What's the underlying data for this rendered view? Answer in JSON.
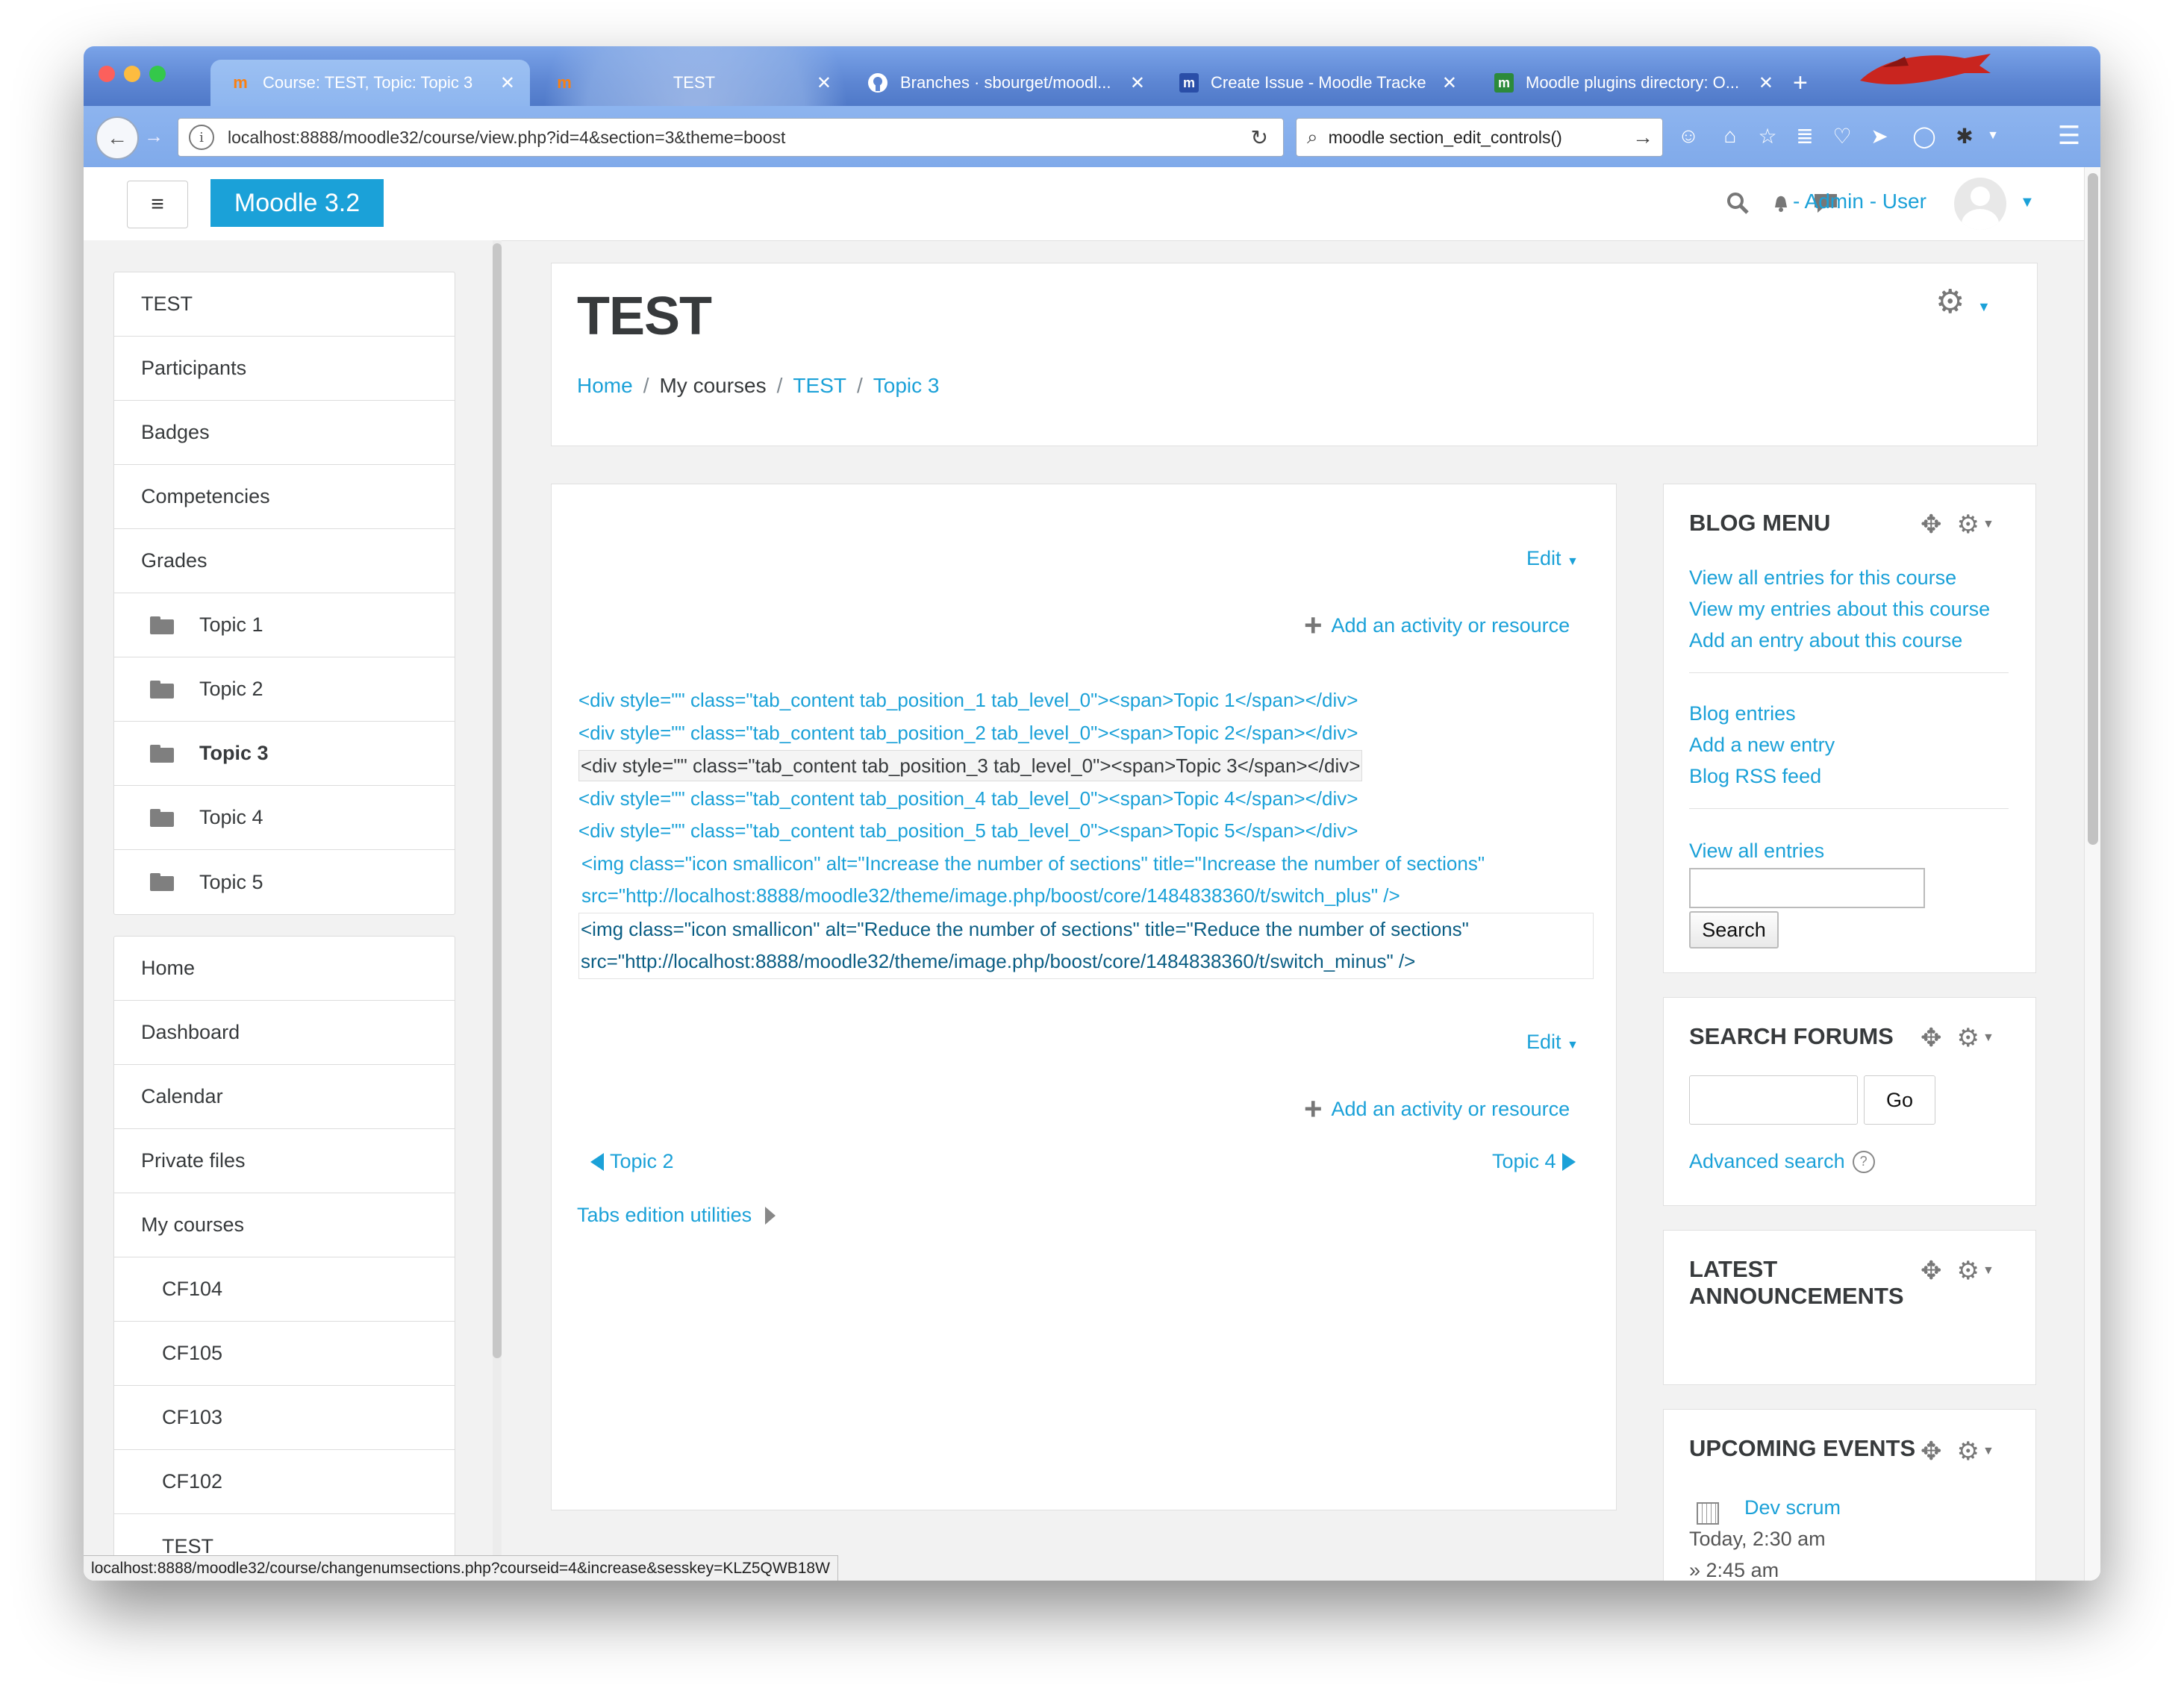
{
  "browser": {
    "tabs": [
      {
        "title": "Course: TEST, Topic: Topic 3",
        "icon": "moodle-icon",
        "active": true
      },
      {
        "title": "TEST",
        "icon": "moodle-icon",
        "active": false
      },
      {
        "title": "Branches · sbourget/moodl...",
        "icon": "github-icon",
        "active": false
      },
      {
        "title": "Create Issue - Moodle Tracker",
        "icon": "moodle-tracker-icon",
        "active": false
      },
      {
        "title": "Moodle plugins directory: O...",
        "icon": "moodle-icon",
        "active": false
      }
    ],
    "url": "localhost:8888/moodle32/course/view.php?id=4&section=3&theme=boost",
    "search_value": "moodle section_edit_controls()"
  },
  "header": {
    "brand": "Moodle 3.2",
    "user_label": "- Admin - User"
  },
  "drawer": {
    "course_items": [
      {
        "label": "TEST"
      },
      {
        "label": "Participants"
      },
      {
        "label": "Badges"
      },
      {
        "label": "Competencies"
      },
      {
        "label": "Grades"
      },
      {
        "label": "Topic 1",
        "folder": true
      },
      {
        "label": "Topic 2",
        "folder": true
      },
      {
        "label": "Topic 3",
        "folder": true,
        "current": true
      },
      {
        "label": "Topic 4",
        "folder": true
      },
      {
        "label": "Topic 5",
        "folder": true
      }
    ],
    "site_items": [
      {
        "label": "Home"
      },
      {
        "label": "Dashboard"
      },
      {
        "label": "Calendar"
      },
      {
        "label": "Private files"
      },
      {
        "label": "My courses"
      },
      {
        "label": "CF104",
        "indent": true
      },
      {
        "label": "CF105",
        "indent": true
      },
      {
        "label": "CF103",
        "indent": true
      },
      {
        "label": "CF102",
        "indent": true
      },
      {
        "label": "TEST",
        "indent": true
      }
    ]
  },
  "course_header": {
    "title": "TEST",
    "breadcrumb": {
      "home": "Home",
      "my_courses": "My courses",
      "course": "TEST",
      "section": "Topic 3"
    }
  },
  "main": {
    "edit_label": "Edit",
    "add_activity_label": "Add an activity or resource",
    "code_lines": [
      "<div style=\"\" class=\"tab_content tab_position_1 tab_level_0\"><span>Topic 1</span></div>",
      "<div style=\"\" class=\"tab_content tab_position_2 tab_level_0\"><span>Topic 2</span></div>",
      "<div style=\"\" class=\"tab_content tab_position_3 tab_level_0\"><span>Topic 3</span></div>",
      "<div style=\"\" class=\"tab_content tab_position_4 tab_level_0\"><span>Topic 4</span></div>",
      "<div style=\"\" class=\"tab_content tab_position_5 tab_level_0\"><span>Topic 5</span></div>",
      "<img class=\"icon smallicon\" alt=\"Increase the number of sections\" title=\"Increase the number of sections\"",
      "src=\"http://localhost:8888/moodle32/theme/image.php/boost/core/1484838360/t/switch_plus\" />",
      "<img class=\"icon smallicon\" alt=\"Reduce the number of sections\" title=\"Reduce the number of sections\"",
      "src=\"http://localhost:8888/moodle32/theme/image.php/boost/core/1484838360/t/switch_minus\" />"
    ],
    "prev_section": "Topic 2",
    "next_section": "Topic 4",
    "tabs_utilities": "Tabs edition utilities"
  },
  "blocks": {
    "blog_menu": {
      "title": "BLOG MENU",
      "links": [
        "View all entries for this course",
        "View my entries about this course",
        "Add an entry about this course"
      ],
      "links2": [
        "Blog entries",
        "Add a new entry",
        "Blog RSS feed"
      ],
      "view_all": "View all entries",
      "search_button": "Search",
      "search_value": ""
    },
    "search_forums": {
      "title": "SEARCH FORUMS",
      "go_button": "Go",
      "advanced": "Advanced search",
      "search_value": ""
    },
    "latest_announcements": {
      "title_line1": "LATEST",
      "title_line2": "ANNOUNCEMENTS"
    },
    "upcoming_events": {
      "title": "UPCOMING EVENTS",
      "event_name": "Dev scrum",
      "event_time": "Today, 2:30 am",
      "event_end": "» 2:45 am"
    }
  },
  "status_bar": "localhost:8888/moodle32/course/changenumsections.php?courseid=4&increase&sesskey=KLZ5QWB18W",
  "colors": {
    "link": "#1ba1d8",
    "brand_bg": "#1ba1d8",
    "text": "#373a3c"
  }
}
